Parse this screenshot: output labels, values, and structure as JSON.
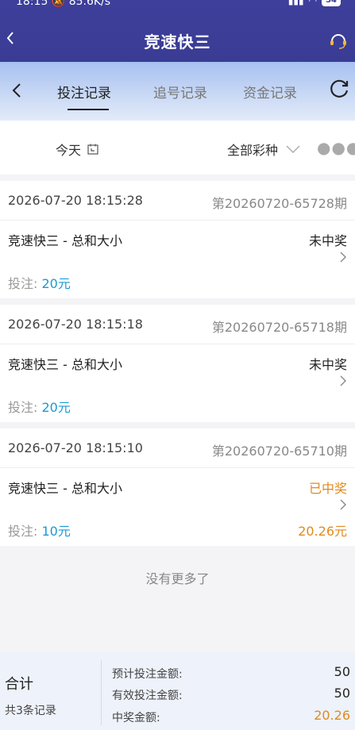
{
  "status_bar": {
    "time": "18:15",
    "speed": "85.6K/s",
    "battery": "54"
  },
  "header": {
    "title": "竞速快三"
  },
  "tabs": [
    {
      "label": "投注记录",
      "active": true
    },
    {
      "label": "追号记录",
      "active": false
    },
    {
      "label": "资金记录",
      "active": false
    }
  ],
  "filter": {
    "date": "今天",
    "lottery": "全部彩种"
  },
  "records": [
    {
      "time": "2026-07-20 18:15:28",
      "issue": "第20260720-65728期",
      "game": "竞速快三 - 总和大小",
      "result": "未中奖",
      "bet_label": "投注:",
      "bet_amount": "20元",
      "prize": ""
    },
    {
      "time": "2026-07-20 18:15:18",
      "issue": "第20260720-65718期",
      "game": "竞速快三 - 总和大小",
      "result": "未中奖",
      "bet_label": "投注:",
      "bet_amount": "20元",
      "prize": ""
    },
    {
      "time": "2026-07-20 18:15:10",
      "issue": "第20260720-65710期",
      "game": "竞速快三 - 总和大小",
      "result": "已中奖",
      "bet_label": "投注:",
      "bet_amount": "10元",
      "prize": "20.26元"
    }
  ],
  "no_more": "没有更多了",
  "summary": {
    "title": "合计",
    "count": "共3条记录",
    "expected_bet_label": "预计投注金额:",
    "expected_bet": "50",
    "valid_bet_label": "有效投注金额:",
    "valid_bet": "50",
    "prize_label": "中奖金额:",
    "prize": "20.26"
  },
  "colors": {
    "header": "#3a3c94",
    "win": "#e08a1e",
    "bet_amount": "#1a9ad6"
  }
}
